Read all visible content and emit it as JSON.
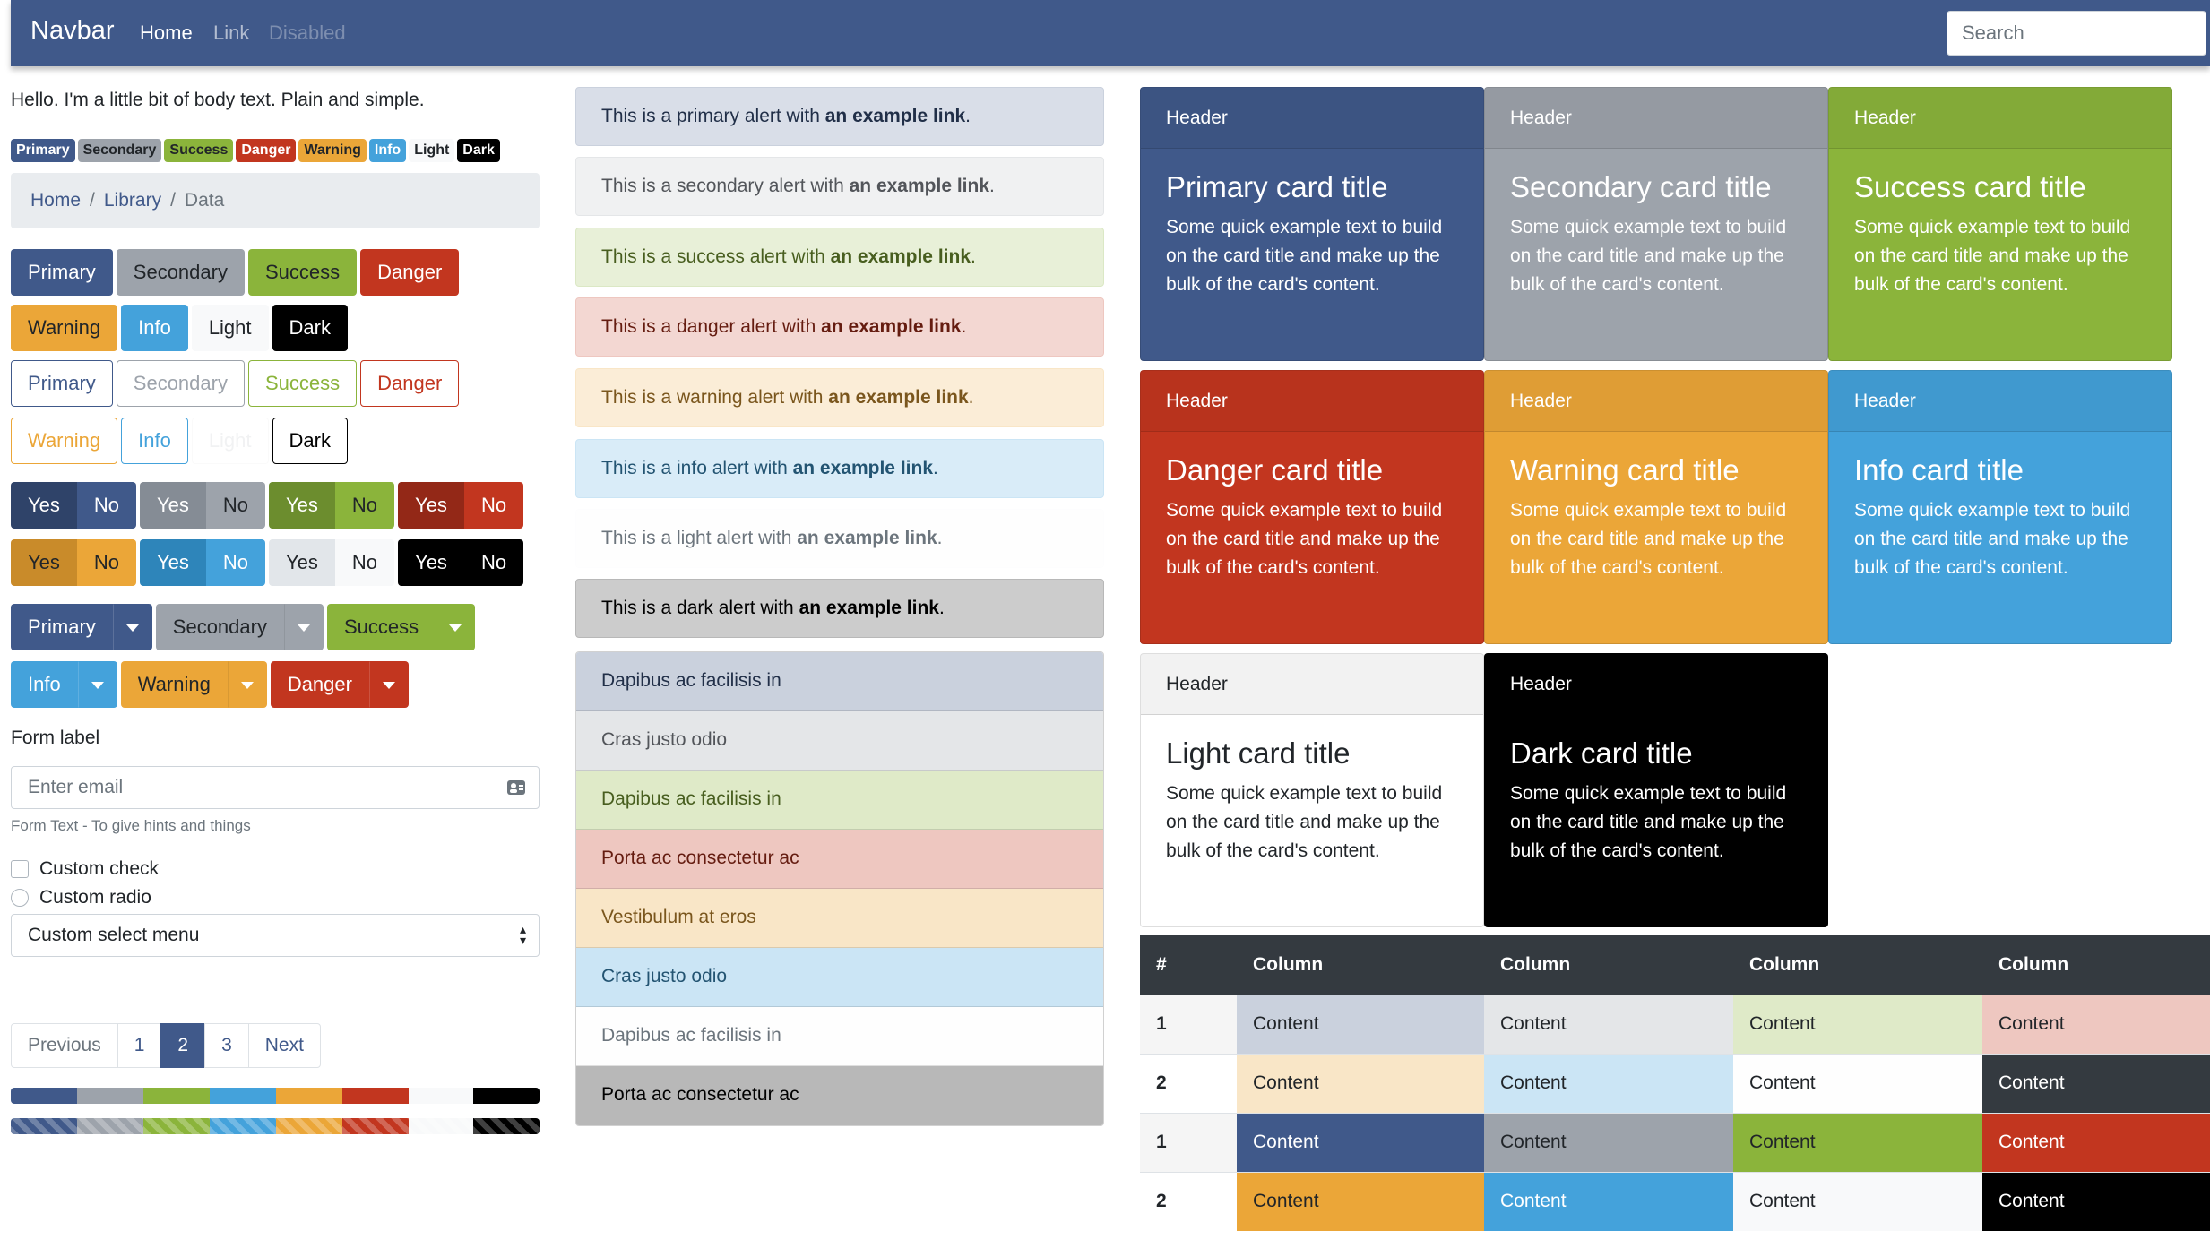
{
  "navbar": {
    "brand": "Navbar",
    "links": [
      {
        "label": "Home",
        "state": "active"
      },
      {
        "label": "Link",
        "state": "normal"
      },
      {
        "label": "Disabled",
        "state": "disabled"
      }
    ],
    "search_placeholder": "Search"
  },
  "colors": {
    "primary": "#40598a",
    "secondary": "#9da3ab",
    "success": "#8bb43b",
    "danger": "#c2361f",
    "warning": "#eba638",
    "info": "#44a2db",
    "light": "#f8f9fa",
    "dark": "#000000"
  },
  "body_text": "Hello. I'm a little bit of body text. Plain and simple.",
  "badges": [
    "Primary",
    "Secondary",
    "Success",
    "Danger",
    "Warning",
    "Info",
    "Light",
    "Dark"
  ],
  "breadcrumb": [
    "Home",
    "Library",
    "Data"
  ],
  "buttons": {
    "solid_row1": [
      "Primary",
      "Secondary",
      "Success",
      "Danger"
    ],
    "solid_row2": [
      "Warning",
      "Info",
      "Light",
      "Dark"
    ],
    "outline_row1": [
      "Primary",
      "Secondary",
      "Success",
      "Danger"
    ],
    "outline_row2": [
      "Warning",
      "Info",
      "Light",
      "Dark"
    ],
    "yes_label": "Yes",
    "no_label": "No",
    "split_row1": [
      "Primary",
      "Secondary",
      "Success"
    ],
    "split_row2": [
      "Info",
      "Warning",
      "Danger"
    ]
  },
  "form": {
    "label": "Form label",
    "email_placeholder": "Enter email",
    "help_text": "Form Text - To give hints and things",
    "check_label": "Custom check",
    "radio_label": "Custom radio",
    "select_value": "Custom select menu"
  },
  "pagination": {
    "previous": "Previous",
    "pages": [
      "1",
      "2",
      "3"
    ],
    "active_page": "2",
    "next": "Next"
  },
  "alerts": {
    "prefixes": [
      "This is a primary alert with ",
      "This is a secondary alert with ",
      "This is a success alert with ",
      "This is a danger alert with ",
      "This is a warning alert with ",
      "This is a info alert with ",
      "This is a light alert with ",
      "This is a dark alert with "
    ],
    "link": "an example link",
    "suffix": "."
  },
  "list_group": [
    "Dapibus ac facilisis in",
    "Cras justo odio",
    "Dapibus ac facilisis in",
    "Porta ac consectetur ac",
    "Vestibulum at eros",
    "Cras justo odio",
    "Dapibus ac facilisis in",
    "Porta ac consectetur ac"
  ],
  "cards": {
    "header": "Header",
    "text": "Some quick example text to build on the card title and make up the bulk of the card's content.",
    "titles": [
      "Primary card title",
      "Secondary card title",
      "Success card title",
      "Danger card title",
      "Warning card title",
      "Info card title",
      "Light card title",
      "Dark card title"
    ]
  },
  "table": {
    "headers": [
      "#",
      "Column",
      "Column",
      "Column",
      "Column"
    ],
    "rows": [
      [
        "1",
        "Content",
        "Content",
        "Content",
        "Content"
      ],
      [
        "2",
        "Content",
        "Content",
        "Content",
        "Content"
      ],
      [
        "1",
        "Content",
        "Content",
        "Content",
        "Content"
      ],
      [
        "2",
        "Content",
        "Content",
        "Content",
        "Content"
      ]
    ]
  }
}
